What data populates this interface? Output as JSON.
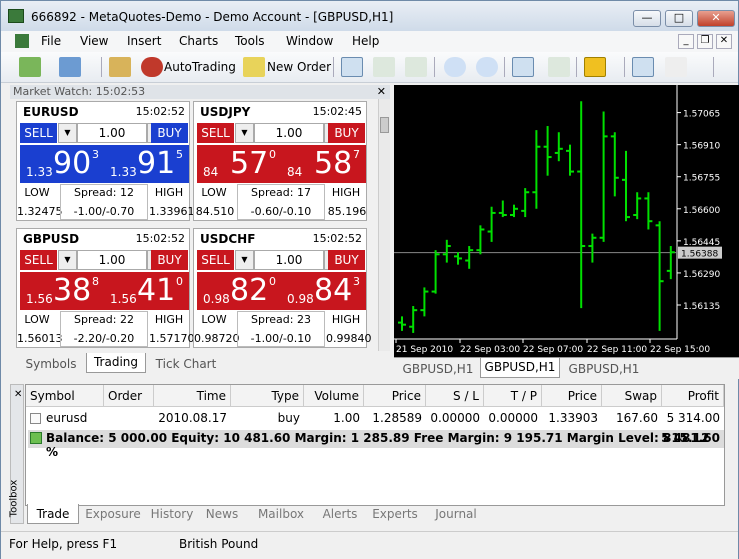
{
  "window": {
    "title": "666892 - MetaQuotes-Demo - Demo Account - [GBPUSD,H1]"
  },
  "menu": [
    "File",
    "View",
    "Insert",
    "Charts",
    "Tools",
    "Window",
    "Help"
  ],
  "toolbar": {
    "autotrading": "AutoTrading",
    "new_order": "New Order"
  },
  "market_watch": {
    "title": "Market Watch: 15:02:53",
    "cards": [
      {
        "symbol": "EURUSD",
        "time": "15:02:52",
        "lot": "1.00",
        "sell_label": "SELL",
        "buy_label": "BUY",
        "sell": {
          "prefix": "1.33",
          "big": "90",
          "sup": "3"
        },
        "buy": {
          "prefix": "1.33",
          "big": "91",
          "sup": "5"
        },
        "low_label": "LOW",
        "high_label": "HIGH",
        "low": "1.32475",
        "high": "1.33961",
        "spread": "Spread: 12",
        "range": "-1.00/-0.70",
        "color": "blue"
      },
      {
        "symbol": "USDJPY",
        "time": "15:02:45",
        "lot": "1.00",
        "sell_label": "SELL",
        "buy_label": "BUY",
        "sell": {
          "prefix": "84",
          "big": "57",
          "sup": "0"
        },
        "buy": {
          "prefix": "84",
          "big": "58",
          "sup": "7"
        },
        "low_label": "LOW",
        "high_label": "HIGH",
        "low": "84.510",
        "high": "85.196",
        "spread": "Spread: 17",
        "range": "-0.60/-0.10",
        "color": "red"
      },
      {
        "symbol": "GBPUSD",
        "time": "15:02:52",
        "lot": "1.00",
        "sell_label": "SELL",
        "buy_label": "BUY",
        "sell": {
          "prefix": "1.56",
          "big": "38",
          "sup": "8"
        },
        "buy": {
          "prefix": "1.56",
          "big": "41",
          "sup": "0"
        },
        "low_label": "LOW",
        "high_label": "HIGH",
        "low": "1.56013",
        "high": "1.57170",
        "spread": "Spread: 22",
        "range": "-2.20/-0.20",
        "color": "red"
      },
      {
        "symbol": "USDCHF",
        "time": "15:02:52",
        "lot": "1.00",
        "sell_label": "SELL",
        "buy_label": "BUY",
        "sell": {
          "prefix": "0.98",
          "big": "82",
          "sup": "0"
        },
        "buy": {
          "prefix": "0.98",
          "big": "84",
          "sup": "3"
        },
        "low_label": "LOW",
        "high_label": "HIGH",
        "low": "0.98720",
        "high": "0.99840",
        "spread": "Spread: 23",
        "range": "-1.00/-0.10",
        "color": "red"
      }
    ],
    "tabs": [
      "Symbols",
      "Trading",
      "Tick Chart"
    ]
  },
  "chart": {
    "price_labels": [
      "1.57065",
      "1.56910",
      "1.56755",
      "1.56600",
      "1.56445",
      "1.56290",
      "1.56135"
    ],
    "current_price": "1.56388",
    "time_labels": [
      "21 Sep 2010",
      "22 Sep 03:00",
      "22 Sep 07:00",
      "22 Sep 11:00",
      "22 Sep 15:00"
    ],
    "tabs": [
      "GBPUSD,H1",
      "GBPUSD,H1",
      "GBPUSD,H1"
    ],
    "bars": [
      [
        1.5608,
        1.5601,
        1.5605,
        1.5604
      ],
      [
        1.5613,
        1.56,
        1.5603,
        1.5611
      ],
      [
        1.5622,
        1.5608,
        1.5611,
        1.562
      ],
      [
        1.564,
        1.5619,
        1.562,
        1.5638
      ],
      [
        1.5645,
        1.5634,
        1.5638,
        1.5642
      ],
      [
        1.5639,
        1.5633,
        1.5637,
        1.5636
      ],
      [
        1.5642,
        1.5631,
        1.5635,
        1.564
      ],
      [
        1.5652,
        1.5638,
        1.564,
        1.565
      ],
      [
        1.5661,
        1.5644,
        1.5649,
        1.5658
      ],
      [
        1.5664,
        1.5656,
        1.5658,
        1.5657
      ],
      [
        1.5662,
        1.5656,
        1.5657,
        1.566
      ],
      [
        1.567,
        1.5656,
        1.5659,
        1.5668
      ],
      [
        1.5698,
        1.566,
        1.5668,
        1.569
      ],
      [
        1.57,
        1.5676,
        1.569,
        1.5685
      ],
      [
        1.5697,
        1.5683,
        1.5687,
        1.5689
      ],
      [
        1.5691,
        1.5676,
        1.5688,
        1.5678
      ],
      [
        1.5712,
        1.5612,
        1.5678,
        1.5642
      ],
      [
        1.5648,
        1.5634,
        1.5642,
        1.5646
      ],
      [
        1.5707,
        1.5644,
        1.5646,
        1.5695
      ],
      [
        1.5697,
        1.5666,
        1.5695,
        1.5675
      ],
      [
        1.5688,
        1.5654,
        1.5674,
        1.5656
      ],
      [
        1.5668,
        1.5655,
        1.5657,
        1.5665
      ],
      [
        1.5668,
        1.565,
        1.5665,
        1.5654
      ],
      [
        1.5654,
        1.5601,
        1.5652,
        1.5625
      ],
      [
        1.5642,
        1.5626,
        1.563,
        1.5639
      ]
    ]
  },
  "terminal": {
    "columns": [
      "Symbol",
      "Order",
      "Time",
      "Type",
      "Volume",
      "Price",
      "S / L",
      "T / P",
      "Price",
      "Swap",
      "Profit"
    ],
    "row": [
      "eurusd",
      "",
      "2010.08.17 ...",
      "buy",
      "1.00",
      "1.28589",
      "0.00000",
      "0.00000",
      "1.33903",
      "167.60",
      "5 314.00"
    ],
    "summary": "Balance: 5 000.00  Equity: 10 481.60  Margin: 1 285.89  Free Margin: 9 195.71  Margin Level: 815.12 %",
    "summary_profit": "5 481.60",
    "tabs": [
      "Trade",
      "Exposure",
      "History",
      "News",
      "Mailbox",
      "Alerts",
      "Experts",
      "Journal"
    ],
    "side_label": "Toolbox"
  },
  "status": {
    "help": "For Help, press F1",
    "symbol_name": "British Pound"
  }
}
